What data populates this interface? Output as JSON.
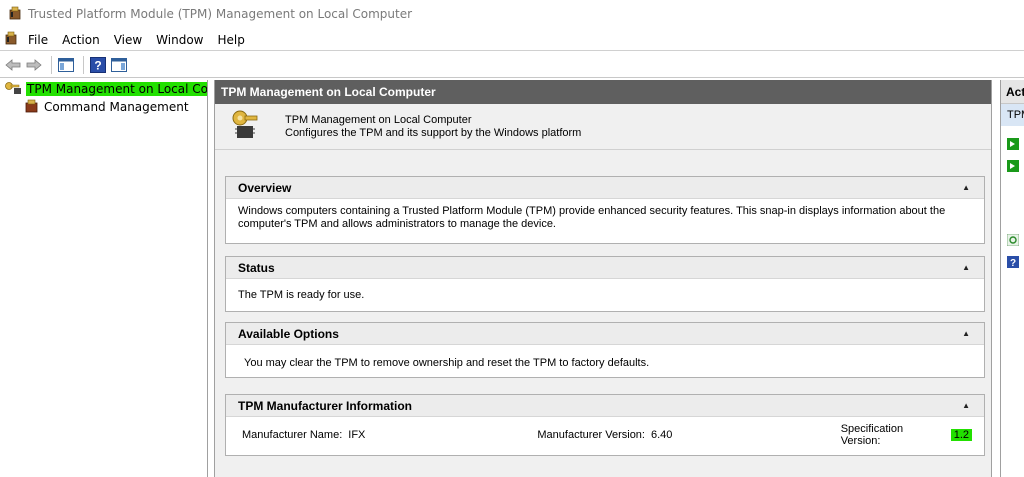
{
  "window": {
    "title": "Trusted Platform Module (TPM) Management on Local Computer"
  },
  "menu": {
    "items": [
      "File",
      "Action",
      "View",
      "Window",
      "Help"
    ]
  },
  "toolbar": {
    "buttons": [
      "back-arrow-icon",
      "forward-arrow-icon",
      "show-hide-console-tree-icon",
      "help-icon",
      "show-hide-action-pane-icon"
    ]
  },
  "tree": {
    "root_label": "TPM Management on Local Comp",
    "child_label": "Command Management"
  },
  "center": {
    "header": "TPM Management on Local Computer",
    "info_title": "TPM Management on Local Computer",
    "info_subtitle": "Configures the TPM and its support by the Windows platform",
    "overview": {
      "title": "Overview",
      "text": "Windows computers containing a Trusted Platform Module (TPM) provide enhanced security features. This snap-in displays information about the computer's TPM and allows administrators to manage the device."
    },
    "status": {
      "title": "Status",
      "text": "The TPM is ready for use."
    },
    "options": {
      "title": "Available Options",
      "text": "You may clear the TPM to remove ownership and reset the TPM to factory defaults."
    },
    "manufacturer": {
      "title": "TPM Manufacturer Information",
      "name_label": "Manufacturer Name:",
      "name_value": "IFX",
      "version_label": "Manufacturer Version:",
      "version_value": "6.40",
      "spec_label": "Specification Version:",
      "spec_value": "1.2"
    },
    "collapse_glyph": "▲"
  },
  "actions": {
    "header": "Acti",
    "subheader": "TPM"
  },
  "colors": {
    "highlight": "#22e000",
    "center_header_bg": "#5f5f5f",
    "action_green": "#1a9a1a"
  }
}
